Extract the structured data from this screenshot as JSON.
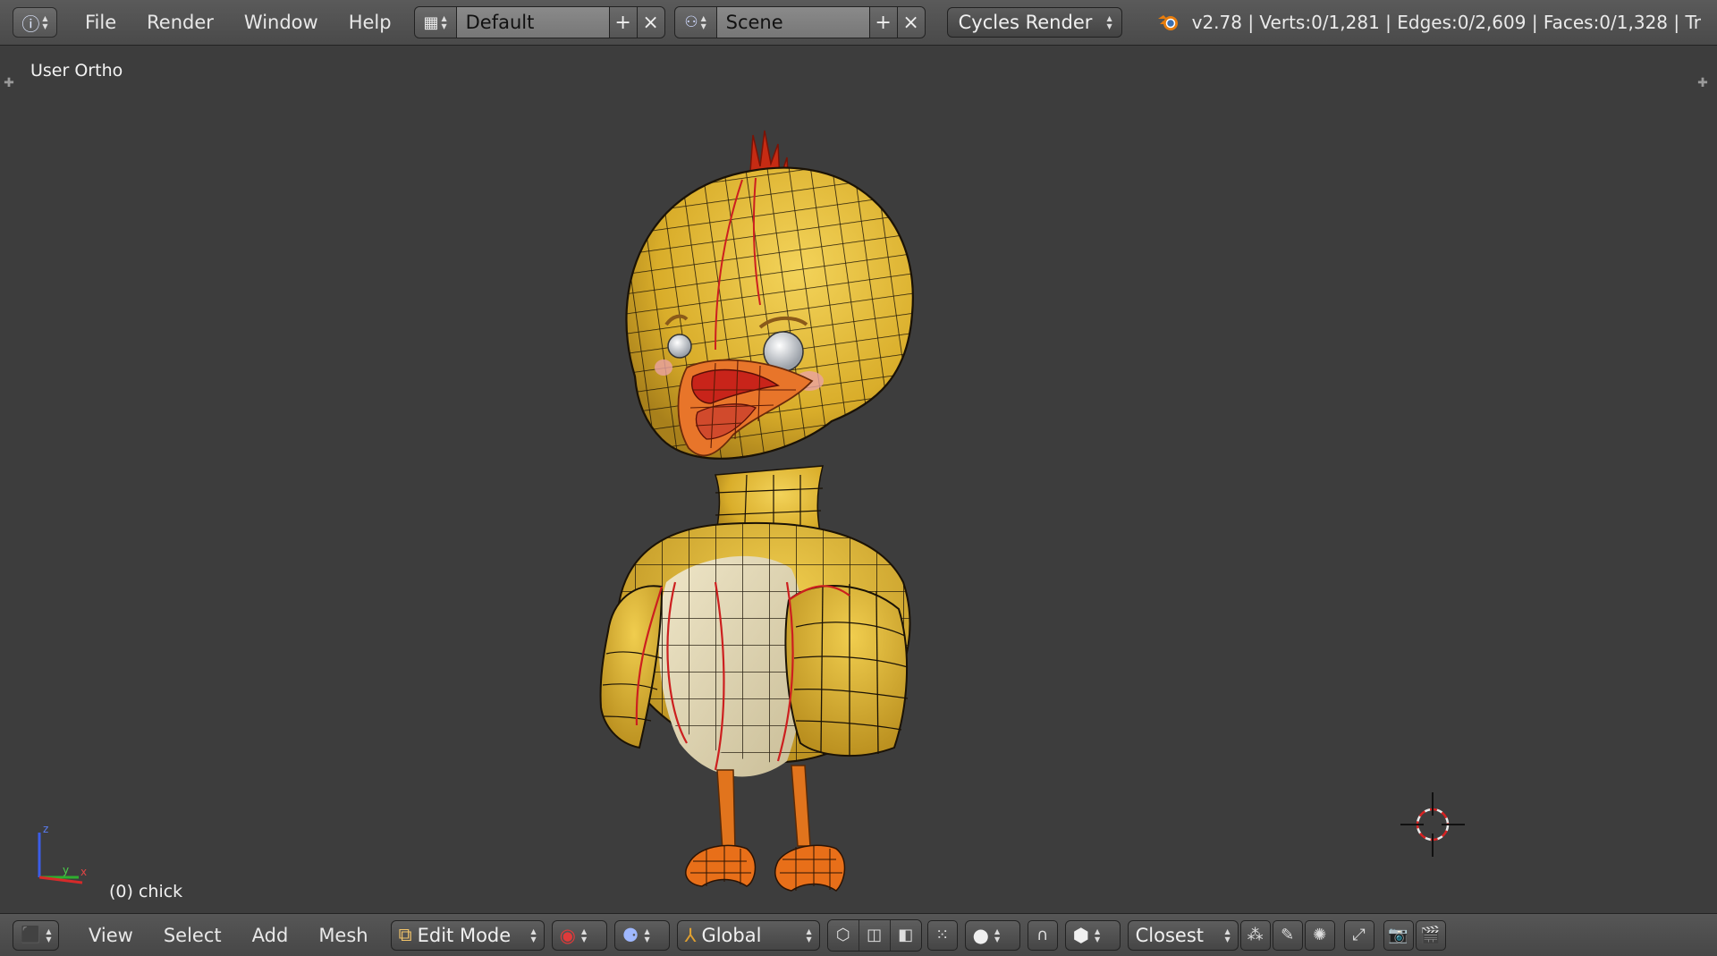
{
  "header": {
    "menus": [
      "File",
      "Render",
      "Window",
      "Help"
    ],
    "screen_layout": "Default",
    "scene": "Scene",
    "render_engine": "Cycles Render",
    "stats": "v2.78 | Verts:0/1,281 | Edges:0/2,609 | Faces:0/1,328 | Tr"
  },
  "viewport": {
    "view_name": "User Ortho",
    "object_label": "(0) chick"
  },
  "footer": {
    "menus": [
      "View",
      "Select",
      "Add",
      "Mesh"
    ],
    "mode": "Edit Mode",
    "orientation": "Global",
    "snap_target": "Closest"
  },
  "colors": {
    "viewport_bg": "#3d3d3d",
    "chick_yellow": "#e6bf3a",
    "belly": "#d9cfb0",
    "beak": "#e8752a",
    "seam": "#cc1f1f"
  }
}
